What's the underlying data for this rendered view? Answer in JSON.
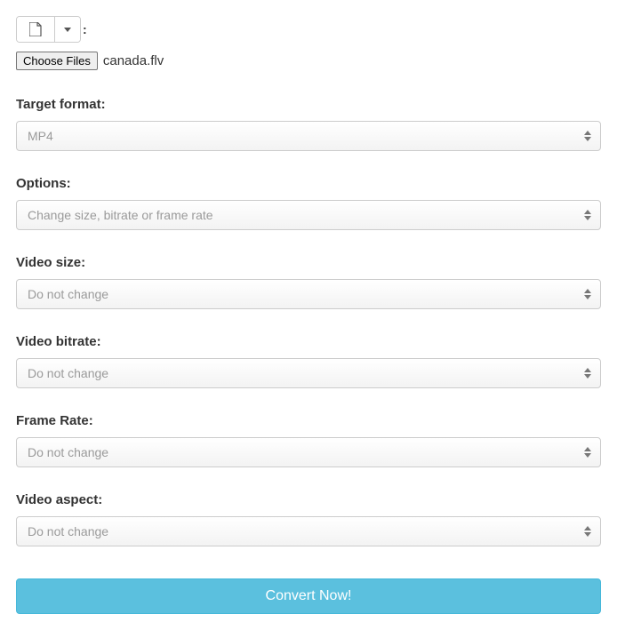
{
  "top": {
    "colon": ":"
  },
  "file": {
    "chooseLabel": "Choose Files",
    "selectedName": "canada.flv"
  },
  "fields": {
    "targetFormat": {
      "label": "Target format:",
      "value": "MP4"
    },
    "options": {
      "label": "Options:",
      "value": "Change size, bitrate or frame rate"
    },
    "videoSize": {
      "label": "Video size:",
      "value": "Do not change"
    },
    "videoBitrate": {
      "label": "Video bitrate:",
      "value": "Do not change"
    },
    "frameRate": {
      "label": "Frame Rate:",
      "value": "Do not change"
    },
    "videoAspect": {
      "label": "Video aspect:",
      "value": "Do not change"
    }
  },
  "convert": {
    "label": "Convert Now!"
  }
}
